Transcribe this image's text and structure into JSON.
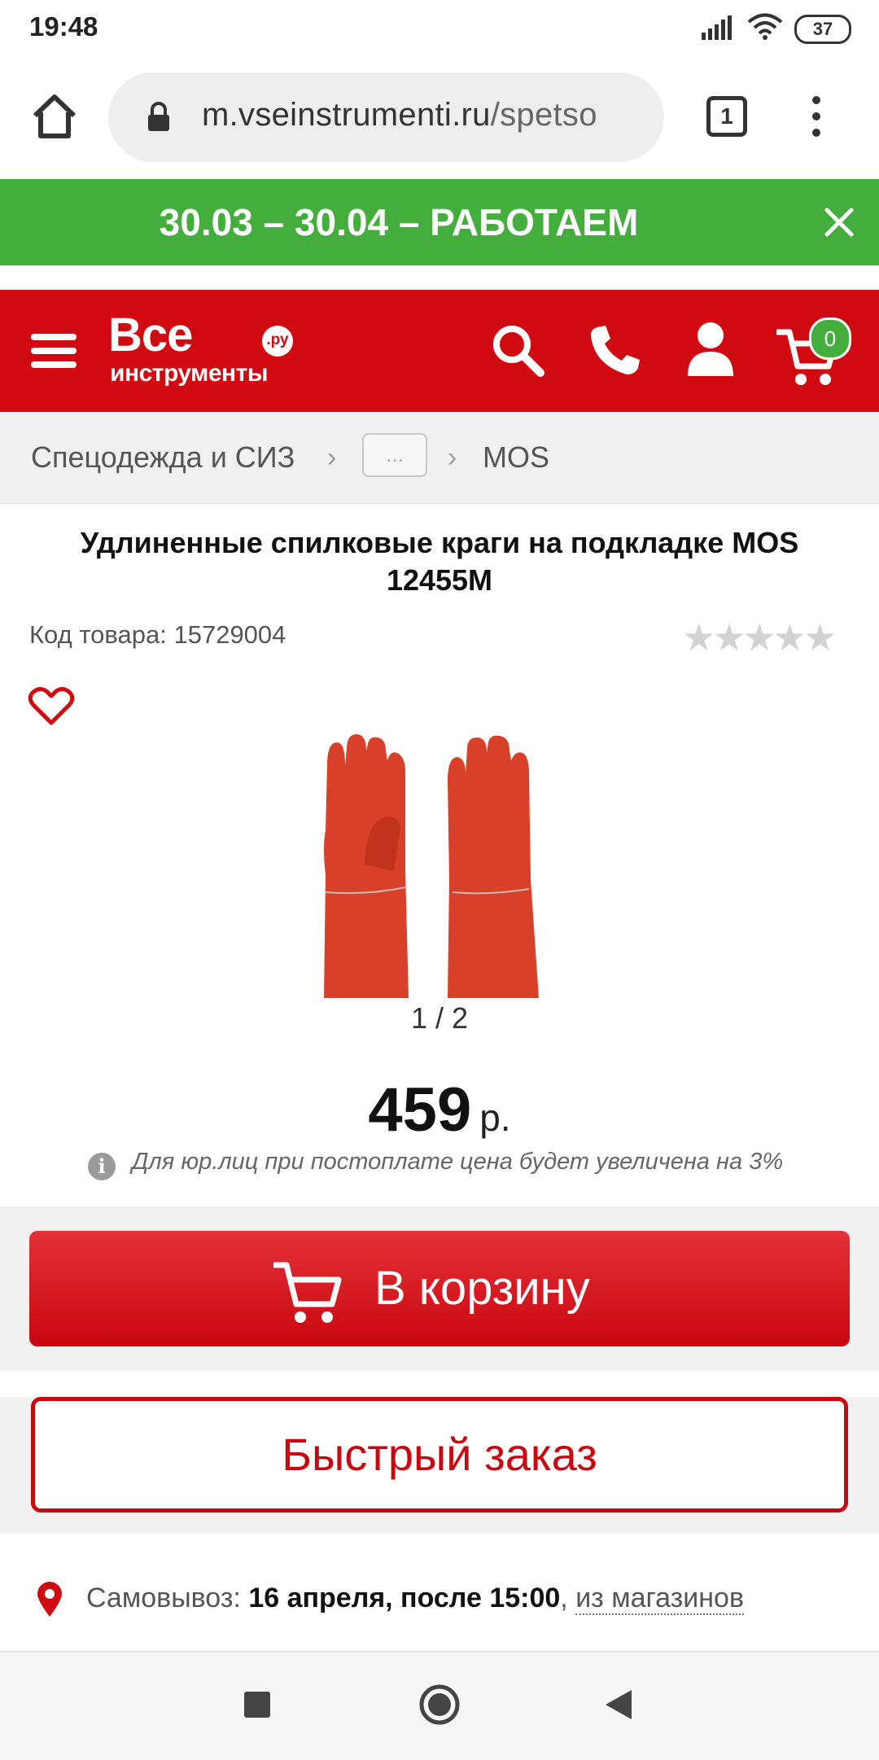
{
  "status_bar": {
    "time": "19:48",
    "battery": "37"
  },
  "browser": {
    "url_host": "m.vseinstrumenti.ru",
    "url_path": "/spetso",
    "tab_count": "1"
  },
  "promo": {
    "text": "30.03 – 30.04 – РАБОТАЕМ",
    "color": "#43ae3c"
  },
  "header": {
    "logo_line1": "Все",
    "logo_line2": "инструменты",
    "logo_ru": ".ру",
    "cart_count": "0",
    "color": "#d10a11"
  },
  "breadcrumb": {
    "item1": "Спецодежда и СИЗ",
    "more": "...",
    "item3": "MOS"
  },
  "product": {
    "title": "Удлиненные спилковые краги на подкладке MOS 12455M",
    "sku": "Код товара: 15729004",
    "rating_stars": "★★★★★",
    "rating_value": 0,
    "image_counter": "1 / 2",
    "price": "459",
    "currency": "р.",
    "price_note": "Для юр.лиц при постоплате цена будет увеличена на 3%"
  },
  "actions": {
    "add_to_cart": "В корзину",
    "quick_order": "Быстрый заказ"
  },
  "pickup": {
    "label": "Самовывоз:",
    "date": "16 апреля, после 15:00",
    "separator": ",",
    "link": "из магазинов"
  }
}
